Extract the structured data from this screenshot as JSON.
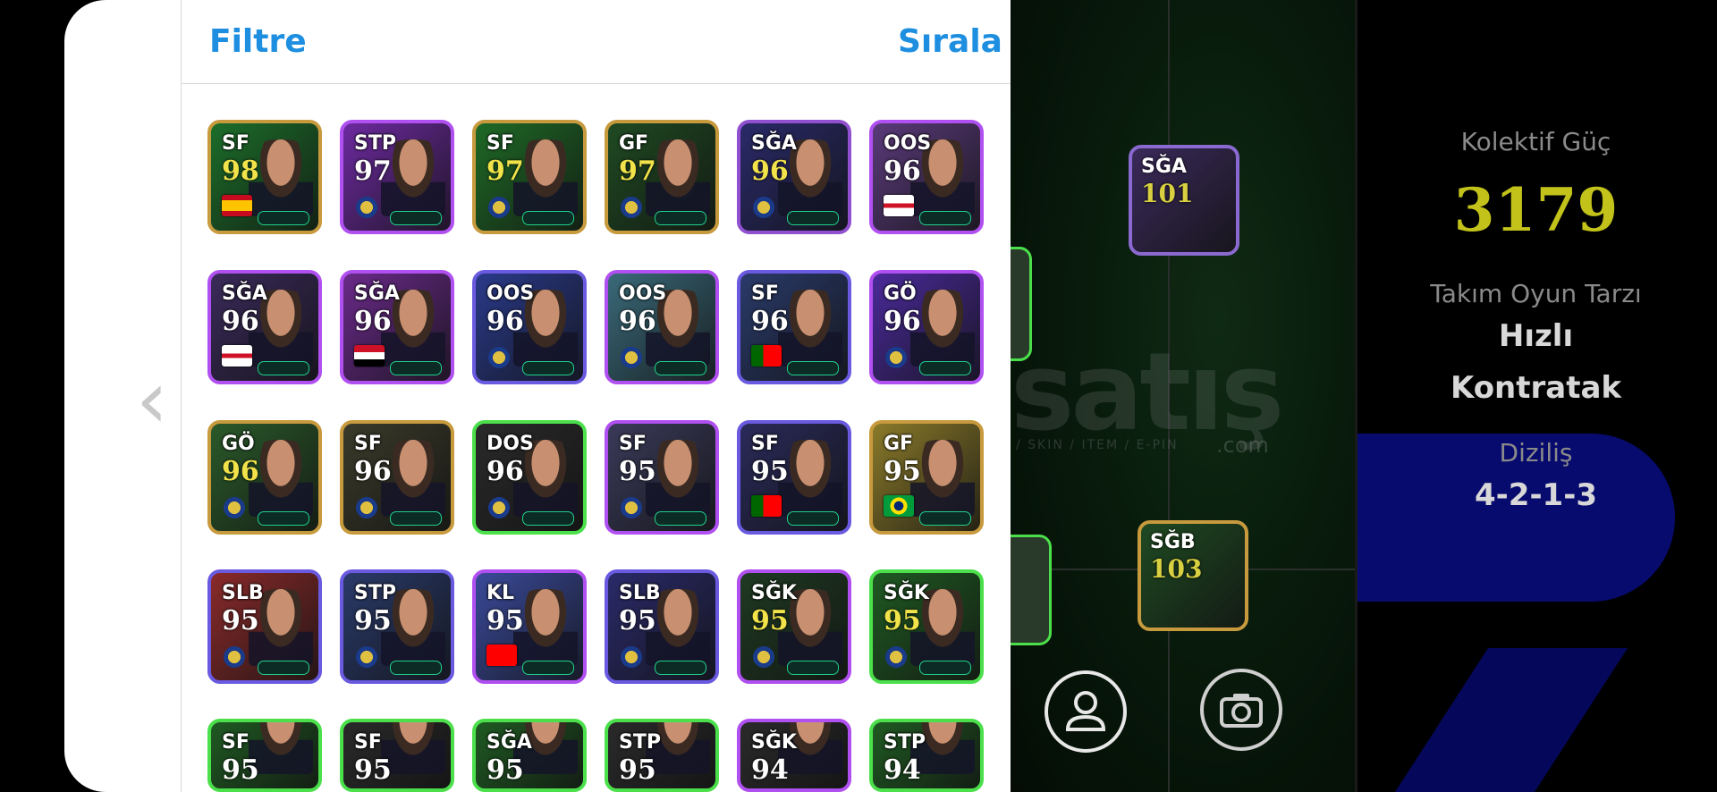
{
  "topbar": {
    "filter_label": "Filtre",
    "sort_label": "Sırala"
  },
  "back_arrow": "‹",
  "cards": [
    {
      "pos": "SF",
      "ovr": "98",
      "frame": "#c89a3e",
      "bg": "#1c6e2a",
      "ovr_color": "#f2e34a",
      "flag": "spain"
    },
    {
      "pos": "STP",
      "ovr": "97",
      "frame": "#b050f0",
      "bg": "#6d2aa0",
      "ovr_color": "#ffffff",
      "flag": "club"
    },
    {
      "pos": "SF",
      "ovr": "97",
      "frame": "#c89a3e",
      "bg": "#1f6a26",
      "ovr_color": "#f2e34a",
      "flag": "club"
    },
    {
      "pos": "GF",
      "ovr": "97",
      "frame": "#c89a3e",
      "bg": "#1f4a22",
      "ovr_color": "#f2e34a",
      "flag": "club"
    },
    {
      "pos": "SĞA",
      "ovr": "96",
      "frame": "#9050d0",
      "bg": "#2a2a6a",
      "ovr_color": "#f2e34a",
      "flag": "club"
    },
    {
      "pos": "OOS",
      "ovr": "96",
      "frame": "#b050f0",
      "bg": "#5a3a7a",
      "ovr_color": "#ffffff",
      "flag": "england"
    },
    {
      "pos": "SĞA",
      "ovr": "96",
      "frame": "#b050f0",
      "bg": "#3a2a5a",
      "ovr_color": "#ffffff",
      "flag": "england"
    },
    {
      "pos": "SĞA",
      "ovr": "96",
      "frame": "#b050f0",
      "bg": "#6a2a8a",
      "ovr_color": "#ffffff",
      "flag": "egypt"
    },
    {
      "pos": "OOS",
      "ovr": "96",
      "frame": "#6a5ae0",
      "bg": "#2a3a8a",
      "ovr_color": "#ffffff",
      "flag": "club"
    },
    {
      "pos": "OOS",
      "ovr": "96",
      "frame": "#b050f0",
      "bg": "#3a6a7a",
      "ovr_color": "#ffffff",
      "flag": "club"
    },
    {
      "pos": "SF",
      "ovr": "96",
      "frame": "#6a5ae0",
      "bg": "#2a3a6a",
      "ovr_color": "#ffffff",
      "flag": "portugal"
    },
    {
      "pos": "GÖ",
      "ovr": "96",
      "frame": "#b050f0",
      "bg": "#4a2a9a",
      "ovr_color": "#ffffff",
      "flag": "club"
    },
    {
      "pos": "GÖ",
      "ovr": "96",
      "frame": "#c89a3e",
      "bg": "#2a5a2a",
      "ovr_color": "#f2e34a",
      "flag": "club"
    },
    {
      "pos": "SF",
      "ovr": "96",
      "frame": "#c89a3e",
      "bg": "#3a3a2a",
      "ovr_color": "#ffffff",
      "flag": "club"
    },
    {
      "pos": "DOS",
      "ovr": "96",
      "frame": "#4be04b",
      "bg": "#2a2a2a",
      "ovr_color": "#ffffff",
      "flag": "club"
    },
    {
      "pos": "SF",
      "ovr": "95",
      "frame": "#b050f0",
      "bg": "#3a3a5a",
      "ovr_color": "#ffffff",
      "flag": "club"
    },
    {
      "pos": "SF",
      "ovr": "95",
      "frame": "#6a5ae0",
      "bg": "#2a2a5a",
      "ovr_color": "#ffffff",
      "flag": "portugal"
    },
    {
      "pos": "GF",
      "ovr": "95",
      "frame": "#c89a3e",
      "bg": "#8a7a2a",
      "ovr_color": "#ffffff",
      "flag": "brazil"
    },
    {
      "pos": "SLB",
      "ovr": "95",
      "frame": "#6a5ae0",
      "bg": "#8a2a2a",
      "ovr_color": "#ffffff",
      "flag": "club"
    },
    {
      "pos": "STP",
      "ovr": "95",
      "frame": "#6a5ae0",
      "bg": "#2a3a6a",
      "ovr_color": "#ffffff",
      "flag": "club"
    },
    {
      "pos": "KL",
      "ovr": "95",
      "frame": "#b050f0",
      "bg": "#3a4a9a",
      "ovr_color": "#ffffff",
      "flag": "switzerland"
    },
    {
      "pos": "SLB",
      "ovr": "95",
      "frame": "#6a5ae0",
      "bg": "#2a2a6a",
      "ovr_color": "#ffffff",
      "flag": "club"
    },
    {
      "pos": "SĞK",
      "ovr": "95",
      "frame": "#b050f0",
      "bg": "#1f3a22",
      "ovr_color": "#f2e34a",
      "flag": "club"
    },
    {
      "pos": "SĞK",
      "ovr": "95",
      "frame": "#4be04b",
      "bg": "#1f5a22",
      "ovr_color": "#f2e34a",
      "flag": "club"
    },
    {
      "pos": "SF",
      "ovr": "95",
      "frame": "#4be04b",
      "bg": "#1f5a22",
      "ovr_color": "#ffffff",
      "flag": "none"
    },
    {
      "pos": "SF",
      "ovr": "95",
      "frame": "#4be04b",
      "bg": "#2a2a2a",
      "ovr_color": "#ffffff",
      "flag": "none"
    },
    {
      "pos": "SĞA",
      "ovr": "95",
      "frame": "#4be04b",
      "bg": "#1f5a22",
      "ovr_color": "#ffffff",
      "flag": "none"
    },
    {
      "pos": "STP",
      "ovr": "95",
      "frame": "#4be04b",
      "bg": "#2a2a2a",
      "ovr_color": "#ffffff",
      "flag": "none"
    },
    {
      "pos": "SĞK",
      "ovr": "94",
      "frame": "#b050f0",
      "bg": "#2a2a2a",
      "ovr_color": "#ffffff",
      "flag": "none"
    },
    {
      "pos": "STP",
      "ovr": "94",
      "frame": "#4be04b",
      "bg": "#1f5a22",
      "ovr_color": "#ffffff",
      "flag": "none"
    }
  ],
  "pitch_cards": [
    {
      "pos": "SĞA",
      "ovr": "101",
      "frame": "#8a6ad0",
      "bg": "#3a2a5a"
    },
    {
      "pos": "SĞB",
      "ovr": "103",
      "frame": "#c89a3e",
      "bg": "#1f4a22"
    }
  ],
  "info": {
    "power_label": "Kolektif Güç",
    "power_value": "3179",
    "style_label": "Takım Oyun Tarzı",
    "style_line1": "Hızlı",
    "style_line2": "Kontratak",
    "formation_label": "Diziliş",
    "formation_value": "4-2-1-3"
  },
  "watermark": {
    "main": "satış",
    "sub": "/ SKIN / ITEM / E-PIN",
    "com": ".com"
  },
  "icons": {
    "profile": "person-icon",
    "camera": "camera-icon"
  }
}
